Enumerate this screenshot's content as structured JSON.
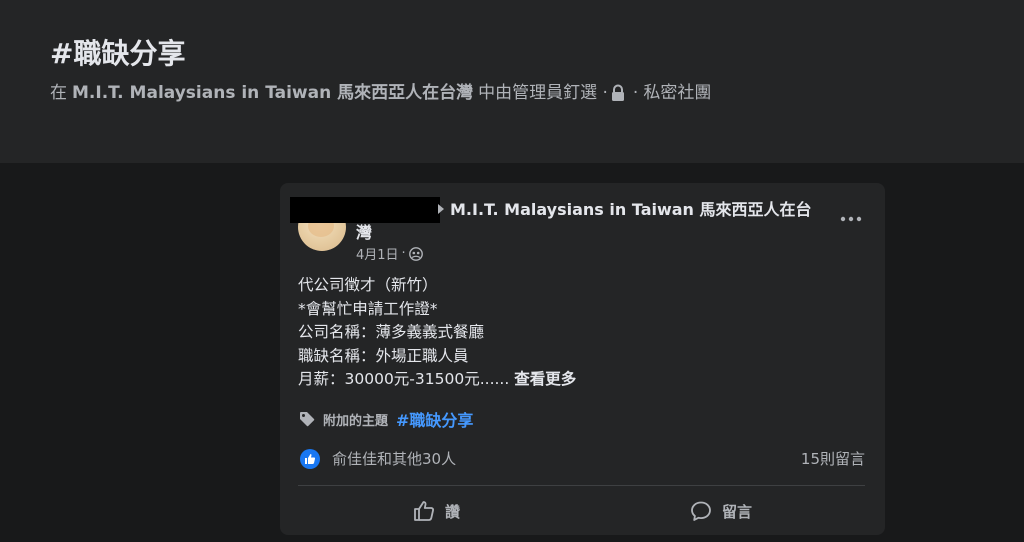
{
  "header": {
    "title": "#職缺分享",
    "prefix": "在",
    "group_name": "M.I.T. Malaysians in Taiwan 馬來西亞人在台灣",
    "pinned_text": "中由管理員釘選 ·",
    "privacy_sep": "·",
    "privacy": "私密社團"
  },
  "post": {
    "group_name": "M.I.T. Malaysians in Taiwan 馬來西亞人在台灣",
    "date": "4月1日",
    "meta_sep": "·",
    "lines": [
      "代公司徵才（新竹）",
      "*會幫忙申請工作證*",
      "公司名稱：薄多義義式餐廳",
      "職缺名稱：外場正職人員",
      "月薪：30000元-31500元......"
    ],
    "see_more": "查看更多",
    "topic_label": "附加的主題",
    "topic": "#職缺分享",
    "reactions_text": "俞佳佳和其他30人",
    "comments_count": "15則留言",
    "like_label": "讚",
    "comment_label": "留言"
  },
  "colors": {
    "background": "#18191a",
    "card": "#242526",
    "text_primary": "#e4e6eb",
    "text_secondary": "#b0b3b8",
    "link": "#4599ff",
    "like_badge": "#1877f2"
  },
  "icons": [
    "lock-icon",
    "globe-icon",
    "more-options-icon",
    "tag-icon",
    "like-badge-icon",
    "thumbs-up-icon",
    "comment-icon"
  ]
}
